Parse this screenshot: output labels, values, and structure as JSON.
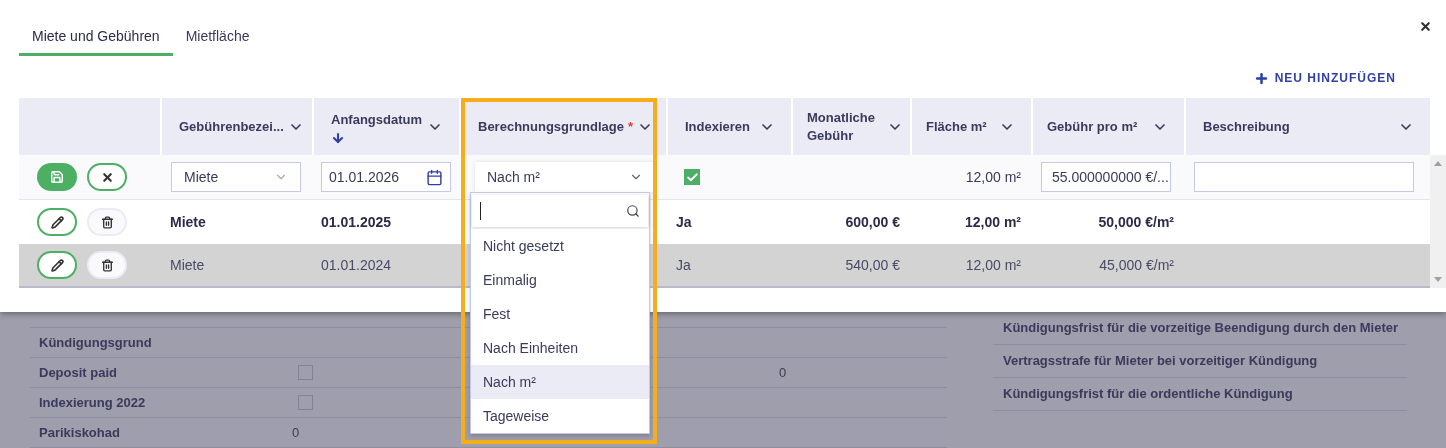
{
  "tabs": [
    {
      "label": "Miete und Gebühren",
      "selected": true
    },
    {
      "label": "Mietfläche",
      "selected": false
    }
  ],
  "add_button": {
    "label": "NEU HINZUFÜGEN"
  },
  "table": {
    "columns": [
      {
        "label": "Gebührenbezei...",
        "sorted_desc": false
      },
      {
        "label": "Anfangsdatum",
        "sorted_desc": true
      },
      {
        "label": "Berechnungsgrundlage",
        "required_mark": "*",
        "sorted_desc": false
      },
      {
        "label": "Indexieren",
        "sorted_desc": false
      },
      {
        "label": "Monatliche Gebühr",
        "sorted_desc": false
      },
      {
        "label": "Fläche m²",
        "sorted_desc": false
      },
      {
        "label": "Gebühr pro m²",
        "sorted_desc": false
      },
      {
        "label": "Beschreibung",
        "sorted_desc": false
      }
    ],
    "edit_row": {
      "fee_name": "Miete",
      "start_date": "01.01.2026",
      "basis": "Nach m²",
      "indexed": true,
      "area": "12,00 m²",
      "fee_per_m2": "55.000000000 €/..."
    },
    "rows": [
      {
        "name": "Miete",
        "start_date": "01.01.2025",
        "indexed": "Ja",
        "monthly_fee": "600,00 €",
        "area": "12,00 m²",
        "fee_per_m2": "50,000 €/m²",
        "bold": true,
        "highlighted": false
      },
      {
        "name": "Miete",
        "start_date": "01.01.2024",
        "indexed": "Ja",
        "monthly_fee": "540,00 €",
        "area": "12,00 m²",
        "fee_per_m2": "45,000 €/m²",
        "bold": false,
        "highlighted": true
      }
    ]
  },
  "dropdown": {
    "options": [
      {
        "label": "Nicht gesetzt",
        "selected": false
      },
      {
        "label": "Einmalig",
        "selected": false
      },
      {
        "label": "Fest",
        "selected": false
      },
      {
        "label": "Nach Einheiten",
        "selected": false
      },
      {
        "label": "Nach m²",
        "selected": true
      },
      {
        "label": "Tageweise",
        "selected": false
      }
    ]
  },
  "background_form": {
    "left": [
      {
        "label": "Kündigungsgrund",
        "kind": "text"
      },
      {
        "label": "Deposit paid",
        "kind": "checkbox",
        "checked": false,
        "column_3": "0"
      },
      {
        "label": "Indexierung 2022",
        "kind": "checkbox",
        "checked": false
      },
      {
        "label": "Parikiskohad",
        "kind": "text",
        "value": "0"
      }
    ],
    "right": [
      {
        "label": "Kündigungsfrist für die vorzeitige Beendigung durch den Mieter"
      },
      {
        "label": "Vertragsstrafe für Mieter bei vorzeitiger Kündigung"
      },
      {
        "label": "Kündigungsfrist für die ordentliche Kündigung"
      }
    ]
  }
}
